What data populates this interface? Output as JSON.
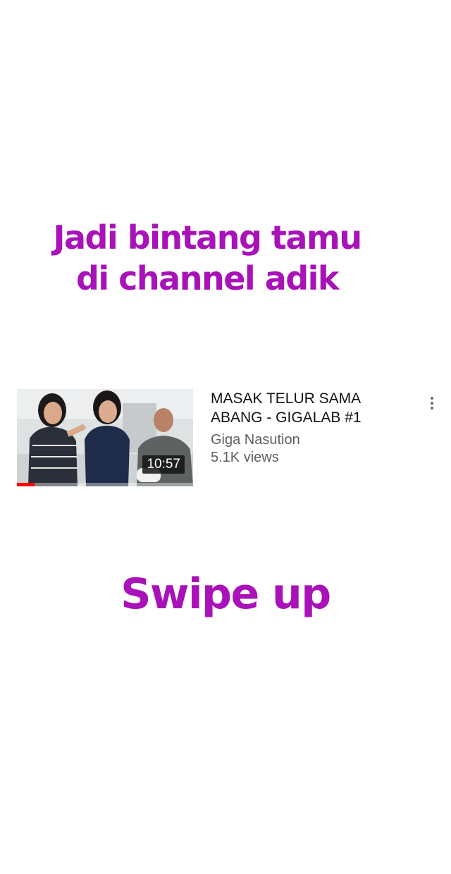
{
  "colors": {
    "accent": "#a812b8",
    "progress_red": "#ff0000"
  },
  "promo": {
    "line1": "Jadi bintang tamu",
    "line2": "di channel adik",
    "cta": "Swipe up"
  },
  "video": {
    "title": "MASAK TELUR SAMA ABANG - GIGALAB #1",
    "channel": "Giga Nasution",
    "views": "5.1K views",
    "duration": "10:57",
    "watched_fraction": 0.1,
    "menu_icon": "more-vert-icon"
  }
}
